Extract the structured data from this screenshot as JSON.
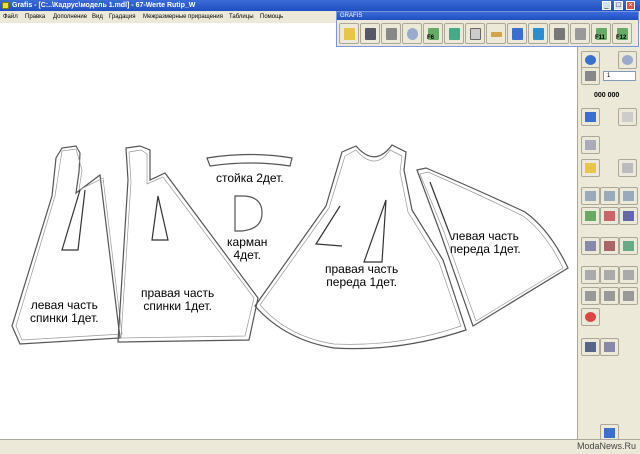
{
  "window": {
    "title": "Grafis - [C:..\\Кадрус\\модель 1.mdl] - 67-Werte Rutip_W"
  },
  "menu": [
    "Файл",
    "Правка",
    "Дополнение",
    "Вид",
    "Градация",
    "Межразмерные приращения",
    "Таблицы",
    "Помощь"
  ],
  "toolbar": {
    "caption": "GRAFIS",
    "keys": [
      "F6",
      "F11",
      "F12"
    ]
  },
  "pieces": {
    "back_left": "левая часть\nспинки 1дет.",
    "back_right": "правая часть\nспинки 1дет.",
    "collar": "стойка 2дет.",
    "pocket": "карман\n4дет.",
    "front_right": "правая часть\nпереда 1дет.",
    "front_left": "левая часть\nпереда 1дет."
  },
  "side_panel": {
    "input_value": "1",
    "counter": "000 000"
  },
  "watermark": "ModaNews.Ru"
}
